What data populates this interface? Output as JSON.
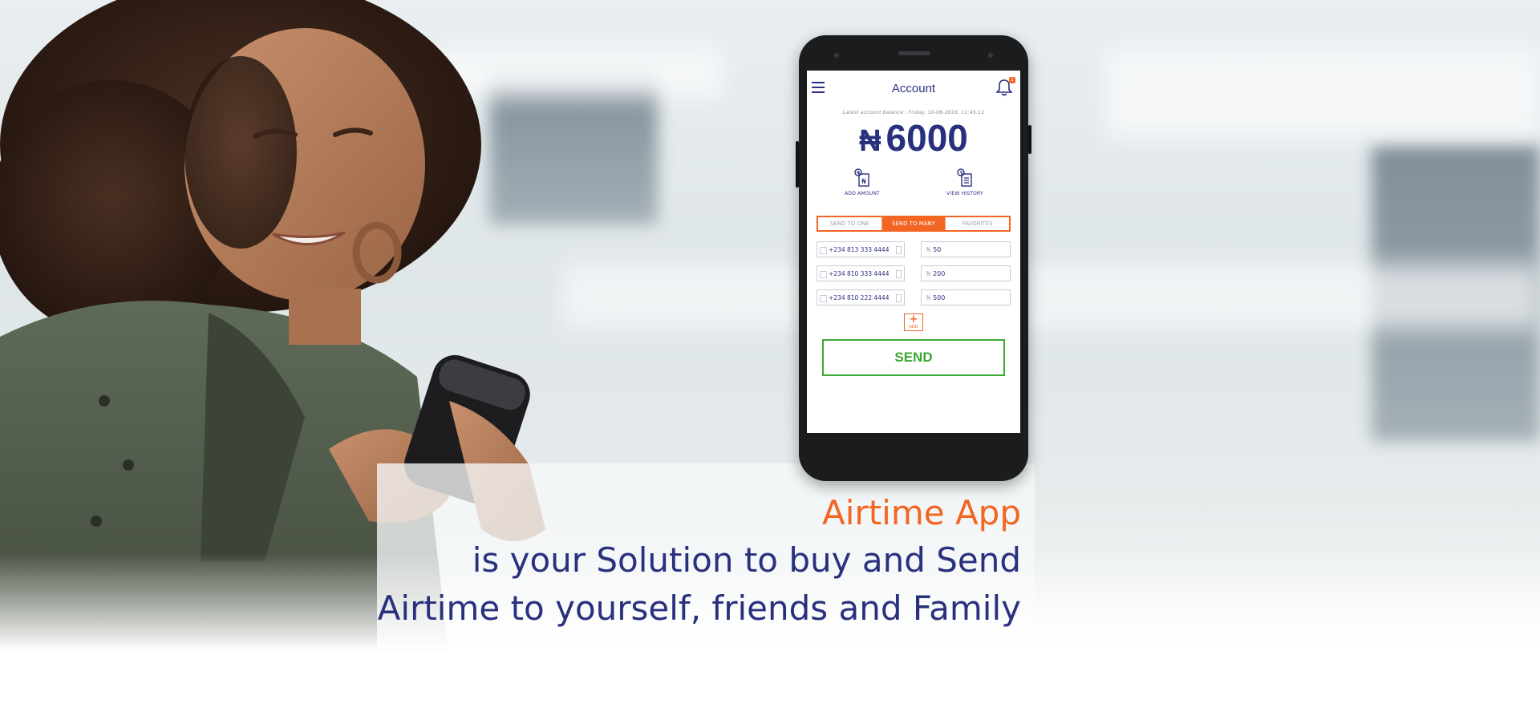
{
  "phone": {
    "header": {
      "title": "Account",
      "notification_count": "1"
    },
    "balance": {
      "caption": "Latest account balance : Friday, 10-06-2016, 11:45:11",
      "currency": "₦",
      "amount": "6000"
    },
    "actions": [
      {
        "label": "ADD AMOUNT",
        "icon": "add-amount-icon"
      },
      {
        "label": "VIEW HISTORY",
        "icon": "view-history-icon"
      }
    ],
    "tabs": [
      {
        "label": "SEND TO ONE",
        "active": false
      },
      {
        "label": "SEND TO MANY",
        "active": true
      },
      {
        "label": "FAVORITES",
        "active": false
      }
    ],
    "recipients": [
      {
        "phone": "+234 813 333 4444",
        "amount": "50"
      },
      {
        "phone": "+234 810 333 4444",
        "amount": "200"
      },
      {
        "phone": "+234 810 222 4444",
        "amount": "500"
      }
    ],
    "amount_currency": "₦",
    "add_label": "ADD",
    "send_label": "SEND"
  },
  "headline": {
    "line1": "Airtime App",
    "line2": "is your Solution to buy and Send",
    "line3": "Airtime to yourself, friends and Family"
  },
  "colors": {
    "brand_orange": "#f26522",
    "brand_navy": "#29307e",
    "send_green": "#3aa832"
  }
}
